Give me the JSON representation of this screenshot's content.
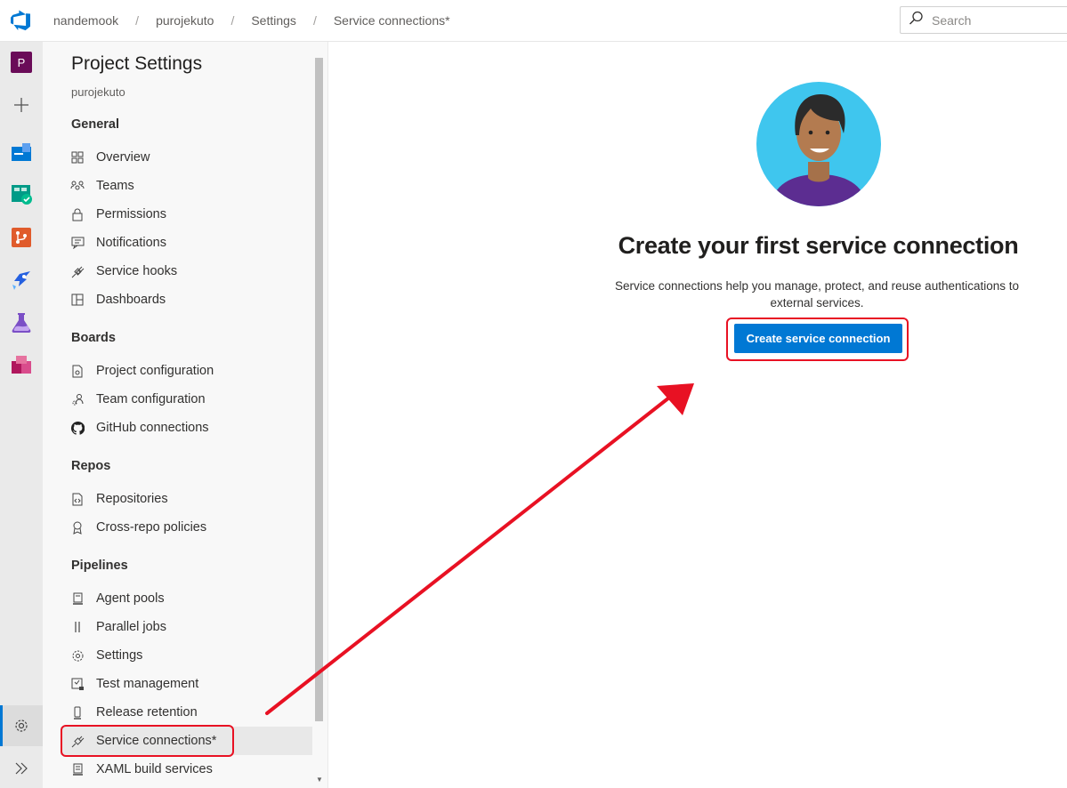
{
  "breadcrumbs": [
    "nandemook",
    "purojekuto",
    "Settings",
    "Service connections*"
  ],
  "search": {
    "placeholder": "Search"
  },
  "rail": {
    "project_initial": "P",
    "items": [
      "project-avatar",
      "new-icon",
      "overview-icon",
      "boards-icon",
      "repos-icon",
      "pipelines-icon",
      "test-plans-icon",
      "artifacts-icon"
    ],
    "bottom": [
      "project-settings-icon",
      "expand-icon"
    ]
  },
  "sidebar": {
    "title": "Project Settings",
    "project": "purojekuto",
    "groups": [
      {
        "label": "General",
        "items": [
          {
            "label": "Overview",
            "icon": "overview-icon"
          },
          {
            "label": "Teams",
            "icon": "teams-icon"
          },
          {
            "label": "Permissions",
            "icon": "lock-icon"
          },
          {
            "label": "Notifications",
            "icon": "notification-icon"
          },
          {
            "label": "Service hooks",
            "icon": "plug-icon"
          },
          {
            "label": "Dashboards",
            "icon": "dashboard-icon"
          }
        ]
      },
      {
        "label": "Boards",
        "items": [
          {
            "label": "Project configuration",
            "icon": "document-settings-icon"
          },
          {
            "label": "Team configuration",
            "icon": "team-settings-icon"
          },
          {
            "label": "GitHub connections",
            "icon": "github-icon"
          }
        ]
      },
      {
        "label": "Repos",
        "items": [
          {
            "label": "Repositories",
            "icon": "repo-icon"
          },
          {
            "label": "Cross-repo policies",
            "icon": "policy-icon"
          }
        ]
      },
      {
        "label": "Pipelines",
        "items": [
          {
            "label": "Agent pools",
            "icon": "agent-pool-icon"
          },
          {
            "label": "Parallel jobs",
            "icon": "parallel-icon"
          },
          {
            "label": "Settings",
            "icon": "gear-icon"
          },
          {
            "label": "Test management",
            "icon": "test-icon"
          },
          {
            "label": "Release retention",
            "icon": "phone-icon"
          },
          {
            "label": "Service connections*",
            "icon": "plug-icon",
            "selected": true
          },
          {
            "label": "XAML build services",
            "icon": "build-icon"
          }
        ]
      }
    ]
  },
  "main": {
    "heading": "Create your first service connection",
    "description": "Service connections help you manage, protect, and reuse authentications to external services.",
    "cta_label": "Create service connection"
  },
  "colors": {
    "accent": "#0078d4",
    "annotation": "#e81123"
  }
}
